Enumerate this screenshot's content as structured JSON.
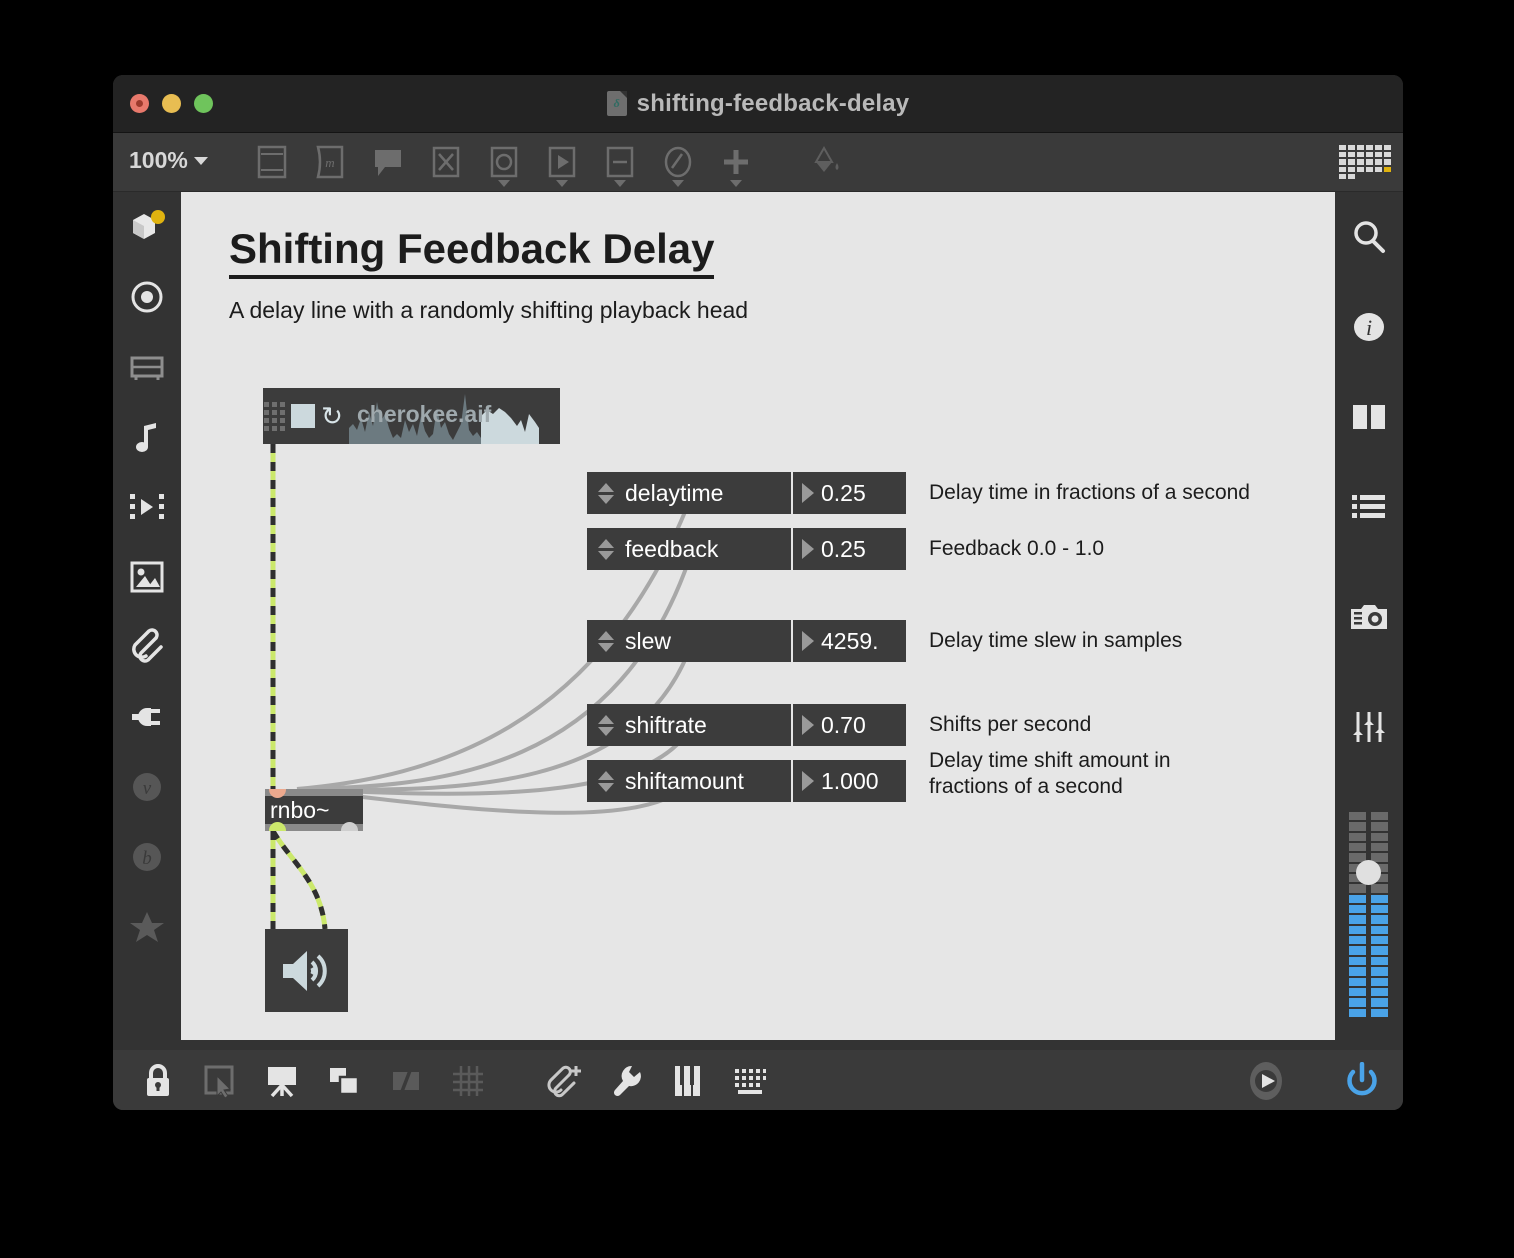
{
  "window": {
    "title": "shifting-feedback-delay",
    "doc_icon": "rnbo-document-icon",
    "traffic_lights": [
      "close-button",
      "minimize-button",
      "zoom-button"
    ]
  },
  "toolbar": {
    "zoom_level": "100%",
    "zoom_caret": "chevron-down-icon",
    "items": [
      {
        "name": "object-box-icon",
        "label": "Object"
      },
      {
        "name": "message-box-icon",
        "label": "Message"
      },
      {
        "name": "comment-icon",
        "label": "Comment"
      },
      {
        "name": "toggle-icon",
        "label": "Toggle"
      },
      {
        "name": "button-bang-icon",
        "label": "Button"
      },
      {
        "name": "playback-icon",
        "label": "Playback"
      },
      {
        "name": "slider-icon",
        "label": "Slider"
      },
      {
        "name": "dial-gauge-icon",
        "label": "Dial"
      },
      {
        "name": "plus-icon",
        "label": "Add Object"
      },
      {
        "name": "paint-bucket-icon",
        "label": "Fill Color"
      }
    ],
    "grid_icon": "pattern-grid-icon"
  },
  "left_sidebar": {
    "items": [
      {
        "name": "sidebar-item-packages",
        "icon": "package-cube-icon",
        "active": true,
        "badge": "yellow-dot"
      },
      {
        "name": "sidebar-item-objects",
        "icon": "target-circle-icon",
        "active": false
      },
      {
        "name": "sidebar-item-rack",
        "icon": "rack-icon",
        "active": false
      },
      {
        "name": "sidebar-item-audio",
        "icon": "music-note-icon",
        "active": false
      },
      {
        "name": "sidebar-item-video",
        "icon": "film-play-icon",
        "active": false
      },
      {
        "name": "sidebar-item-images",
        "icon": "image-icon",
        "active": false
      },
      {
        "name": "sidebar-item-attachments",
        "icon": "paperclip-icon",
        "active": false
      },
      {
        "name": "sidebar-item-devices",
        "icon": "plug-icon",
        "active": false
      },
      {
        "name": "sidebar-item-vizzie",
        "icon": "letter-v-circle-icon",
        "active": false
      },
      {
        "name": "sidebar-item-beap",
        "icon": "letter-b-circle-icon",
        "active": false
      },
      {
        "name": "sidebar-item-favorites",
        "icon": "star-icon",
        "active": false
      }
    ]
  },
  "right_sidebar": {
    "items": [
      {
        "name": "sidebar-search",
        "icon": "search-icon"
      },
      {
        "name": "sidebar-info",
        "icon": "info-icon"
      },
      {
        "name": "sidebar-panels",
        "icon": "columns-icon"
      },
      {
        "name": "sidebar-list",
        "icon": "list-icon"
      },
      {
        "name": "sidebar-snapshot",
        "icon": "camera-icon"
      },
      {
        "name": "sidebar-mixer",
        "icon": "sliders-icon"
      }
    ],
    "meter": {
      "name": "audio-output-meter",
      "channels": 2,
      "segments": 20,
      "lit_segments": 12,
      "knob": "volume-knob",
      "lit_color": "#4aa3e8",
      "unlit_color": "#6a6a6a"
    }
  },
  "patcher": {
    "title": "Shifting Feedback Delay",
    "subtitle": "A delay line with a randomly shifting playback head",
    "playlist": {
      "name": "playlist-object",
      "file": "cherokee.aif",
      "loop_icon": "loop-icon",
      "stop_square": "stop-square",
      "grip": "grip-dots-icon"
    },
    "rnbo_object": {
      "name": "rnbo-object",
      "label": "rnbo~"
    },
    "ezdac": {
      "name": "audio-output-object",
      "icon": "speaker-icon"
    },
    "params": [
      {
        "name": "param-delaytime",
        "label": "delaytime",
        "value": "0.25",
        "desc": "Delay time in fractions of a second"
      },
      {
        "name": "param-feedback",
        "label": "feedback",
        "value": "0.25",
        "desc": "Feedback 0.0 - 1.0"
      },
      {
        "name": "param-slew",
        "label": "slew",
        "value": "4259.",
        "desc": "Delay time slew in samples"
      },
      {
        "name": "param-shiftrate",
        "label": "shiftrate",
        "value": "0.70",
        "desc": "Shifts per second"
      },
      {
        "name": "param-shiftamount",
        "label": "shiftamount",
        "value": "1.000",
        "desc": "Delay time shift amount in\nfractions of a second"
      }
    ]
  },
  "bottom_toolbar": {
    "left_items": [
      {
        "name": "lock-button",
        "icon": "lock-icon",
        "active": true
      },
      {
        "name": "edit-mode-button",
        "icon": "pointer-select-icon",
        "active": false
      },
      {
        "name": "presentation-mode-button",
        "icon": "presentation-icon",
        "active": true
      },
      {
        "name": "arrange-objects-button",
        "icon": "duplicate-objects-icon",
        "active": true
      },
      {
        "name": "annotation-button",
        "icon": "flag-icon",
        "active": false
      },
      {
        "name": "grid-snap-button",
        "icon": "grid-icon",
        "active": false
      },
      {
        "name": "add-attachment-button",
        "icon": "paperclip-plus-icon",
        "active": true
      },
      {
        "name": "inspector-button",
        "icon": "wrench-icon",
        "active": true
      },
      {
        "name": "keyboard-piano-button",
        "icon": "piano-keys-icon",
        "active": true
      },
      {
        "name": "computer-keyboard-button",
        "icon": "keyboard-icon",
        "active": true
      }
    ],
    "right_items": [
      {
        "name": "transport-play-button",
        "icon": "play-circle-icon",
        "active": true
      },
      {
        "name": "audio-power-button",
        "icon": "power-icon",
        "color": "#4aa3e8"
      }
    ]
  },
  "colors": {
    "canvas": "#e6e6e6",
    "chrome": "#333333",
    "object_box": "#3c3c3c",
    "signal_cord": "#cbe86b",
    "data_cord": "#a8a8a8",
    "accent": "#4aa3e8",
    "inlet": "#eda98e"
  }
}
